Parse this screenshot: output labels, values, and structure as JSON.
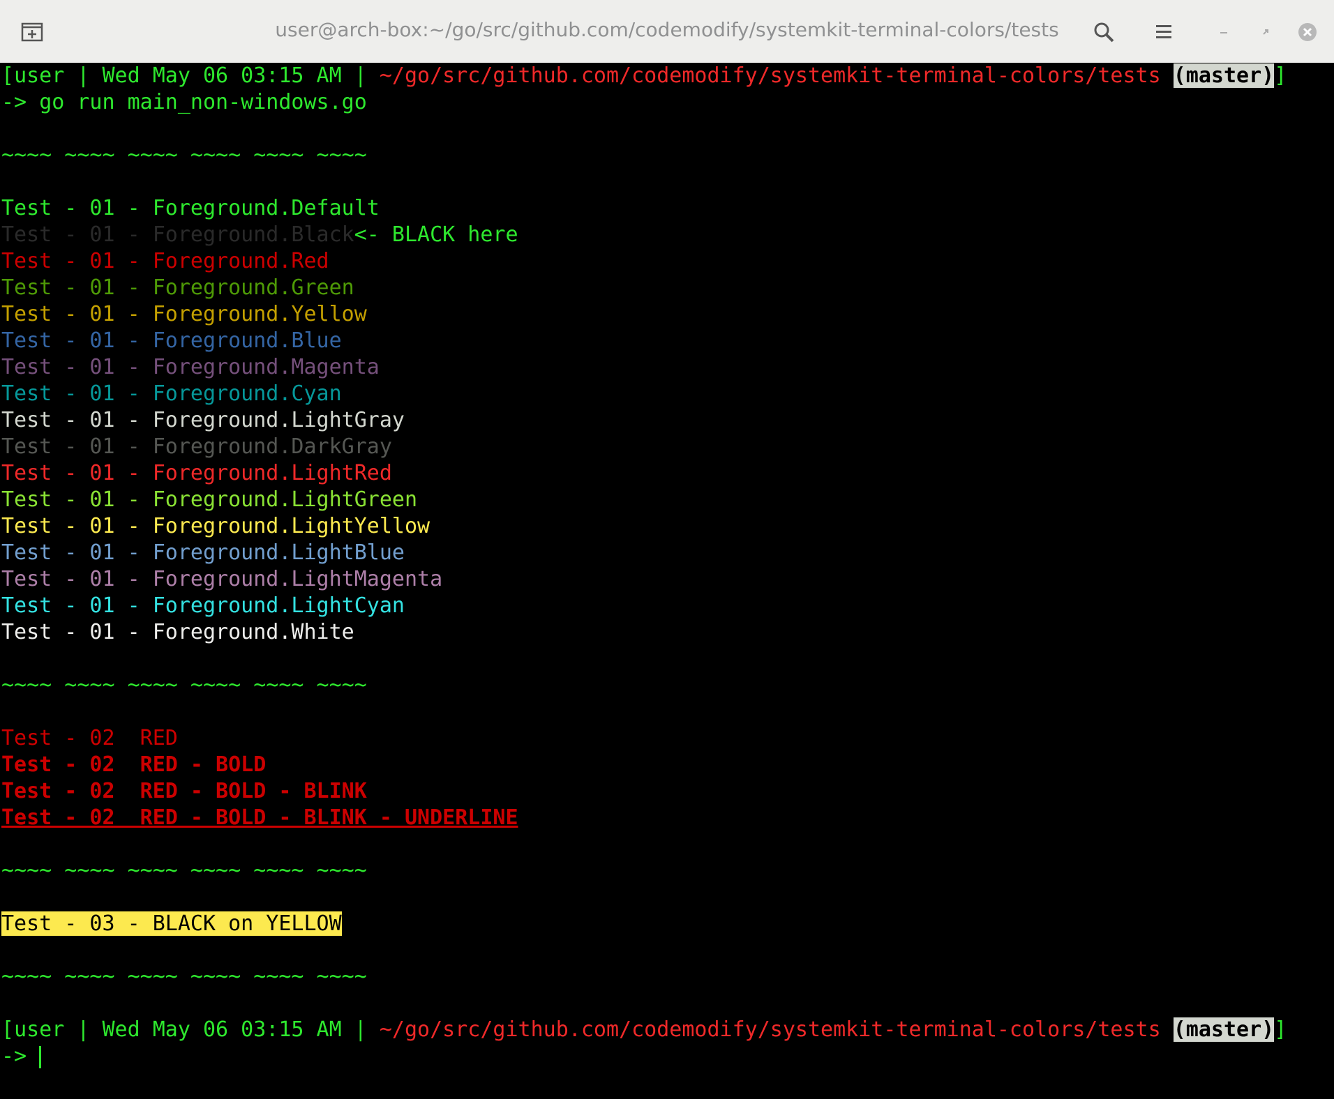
{
  "window": {
    "title": "user@arch-box:~/go/src/github.com/codemodify/systemkit-terminal-colors/tests",
    "icons": [
      "new-tab-icon",
      "search-icon",
      "hamburger-menu-icon",
      "minimize-icon",
      "maximize-icon",
      "close-icon"
    ]
  },
  "prompt": {
    "open": "[",
    "user": "user",
    "sep": " | ",
    "datetime": "Wed May 06 03:15 AM",
    "path": "~/go/src/github.com/codemodify/systemkit-terminal-colors/tests",
    "branch": "(master)",
    "close": "]",
    "arrow": "-> "
  },
  "command": "go run main_non-windows.go",
  "separator": "~~~~ ~~~~ ~~~~ ~~~~ ~~~~ ~~~~",
  "test01": {
    "rows": [
      {
        "text": "Test - 01 - Foreground.Default",
        "color": "#2ee82e"
      },
      {
        "text": "Test - 01 - Foreground.Black",
        "color": "#2a2a2a",
        "note": "<- BLACK here"
      },
      {
        "text": "Test - 01 - Foreground.Red",
        "color": "#cc0000"
      },
      {
        "text": "Test - 01 - Foreground.Green",
        "color": "#4e9a06"
      },
      {
        "text": "Test - 01 - Foreground.Yellow",
        "color": "#c4a000"
      },
      {
        "text": "Test - 01 - Foreground.Blue",
        "color": "#3465a4"
      },
      {
        "text": "Test - 01 - Foreground.Magenta",
        "color": "#75507b"
      },
      {
        "text": "Test - 01 - Foreground.Cyan",
        "color": "#06989a"
      },
      {
        "text": "Test - 01 - Foreground.LightGray",
        "color": "#d3d7cf"
      },
      {
        "text": "Test - 01 - Foreground.DarkGray",
        "color": "#555753"
      },
      {
        "text": "Test - 01 - Foreground.LightRed",
        "color": "#ef2929"
      },
      {
        "text": "Test - 01 - Foreground.LightGreen",
        "color": "#8ae234"
      },
      {
        "text": "Test - 01 - Foreground.LightYellow",
        "color": "#fce94f"
      },
      {
        "text": "Test - 01 - Foreground.LightBlue",
        "color": "#729fcf"
      },
      {
        "text": "Test - 01 - Foreground.LightMagenta",
        "color": "#ad7fa8"
      },
      {
        "text": "Test - 01 - Foreground.LightCyan",
        "color": "#34e2e2"
      },
      {
        "text": "Test - 01 - Foreground.White",
        "color": "#eeeeec"
      }
    ]
  },
  "test02": {
    "color": "#cc0000",
    "rows": [
      "Test - 02  RED",
      "Test - 02  RED - BOLD",
      "Test - 02  RED - BOLD - BLINK",
      "Test - 02  RED - BOLD - BLINK - UNDERLINE"
    ]
  },
  "test03": {
    "text": "Test - 03 - BLACK on YELLOW",
    "bg": "#fce94f",
    "fg": "#000000"
  }
}
